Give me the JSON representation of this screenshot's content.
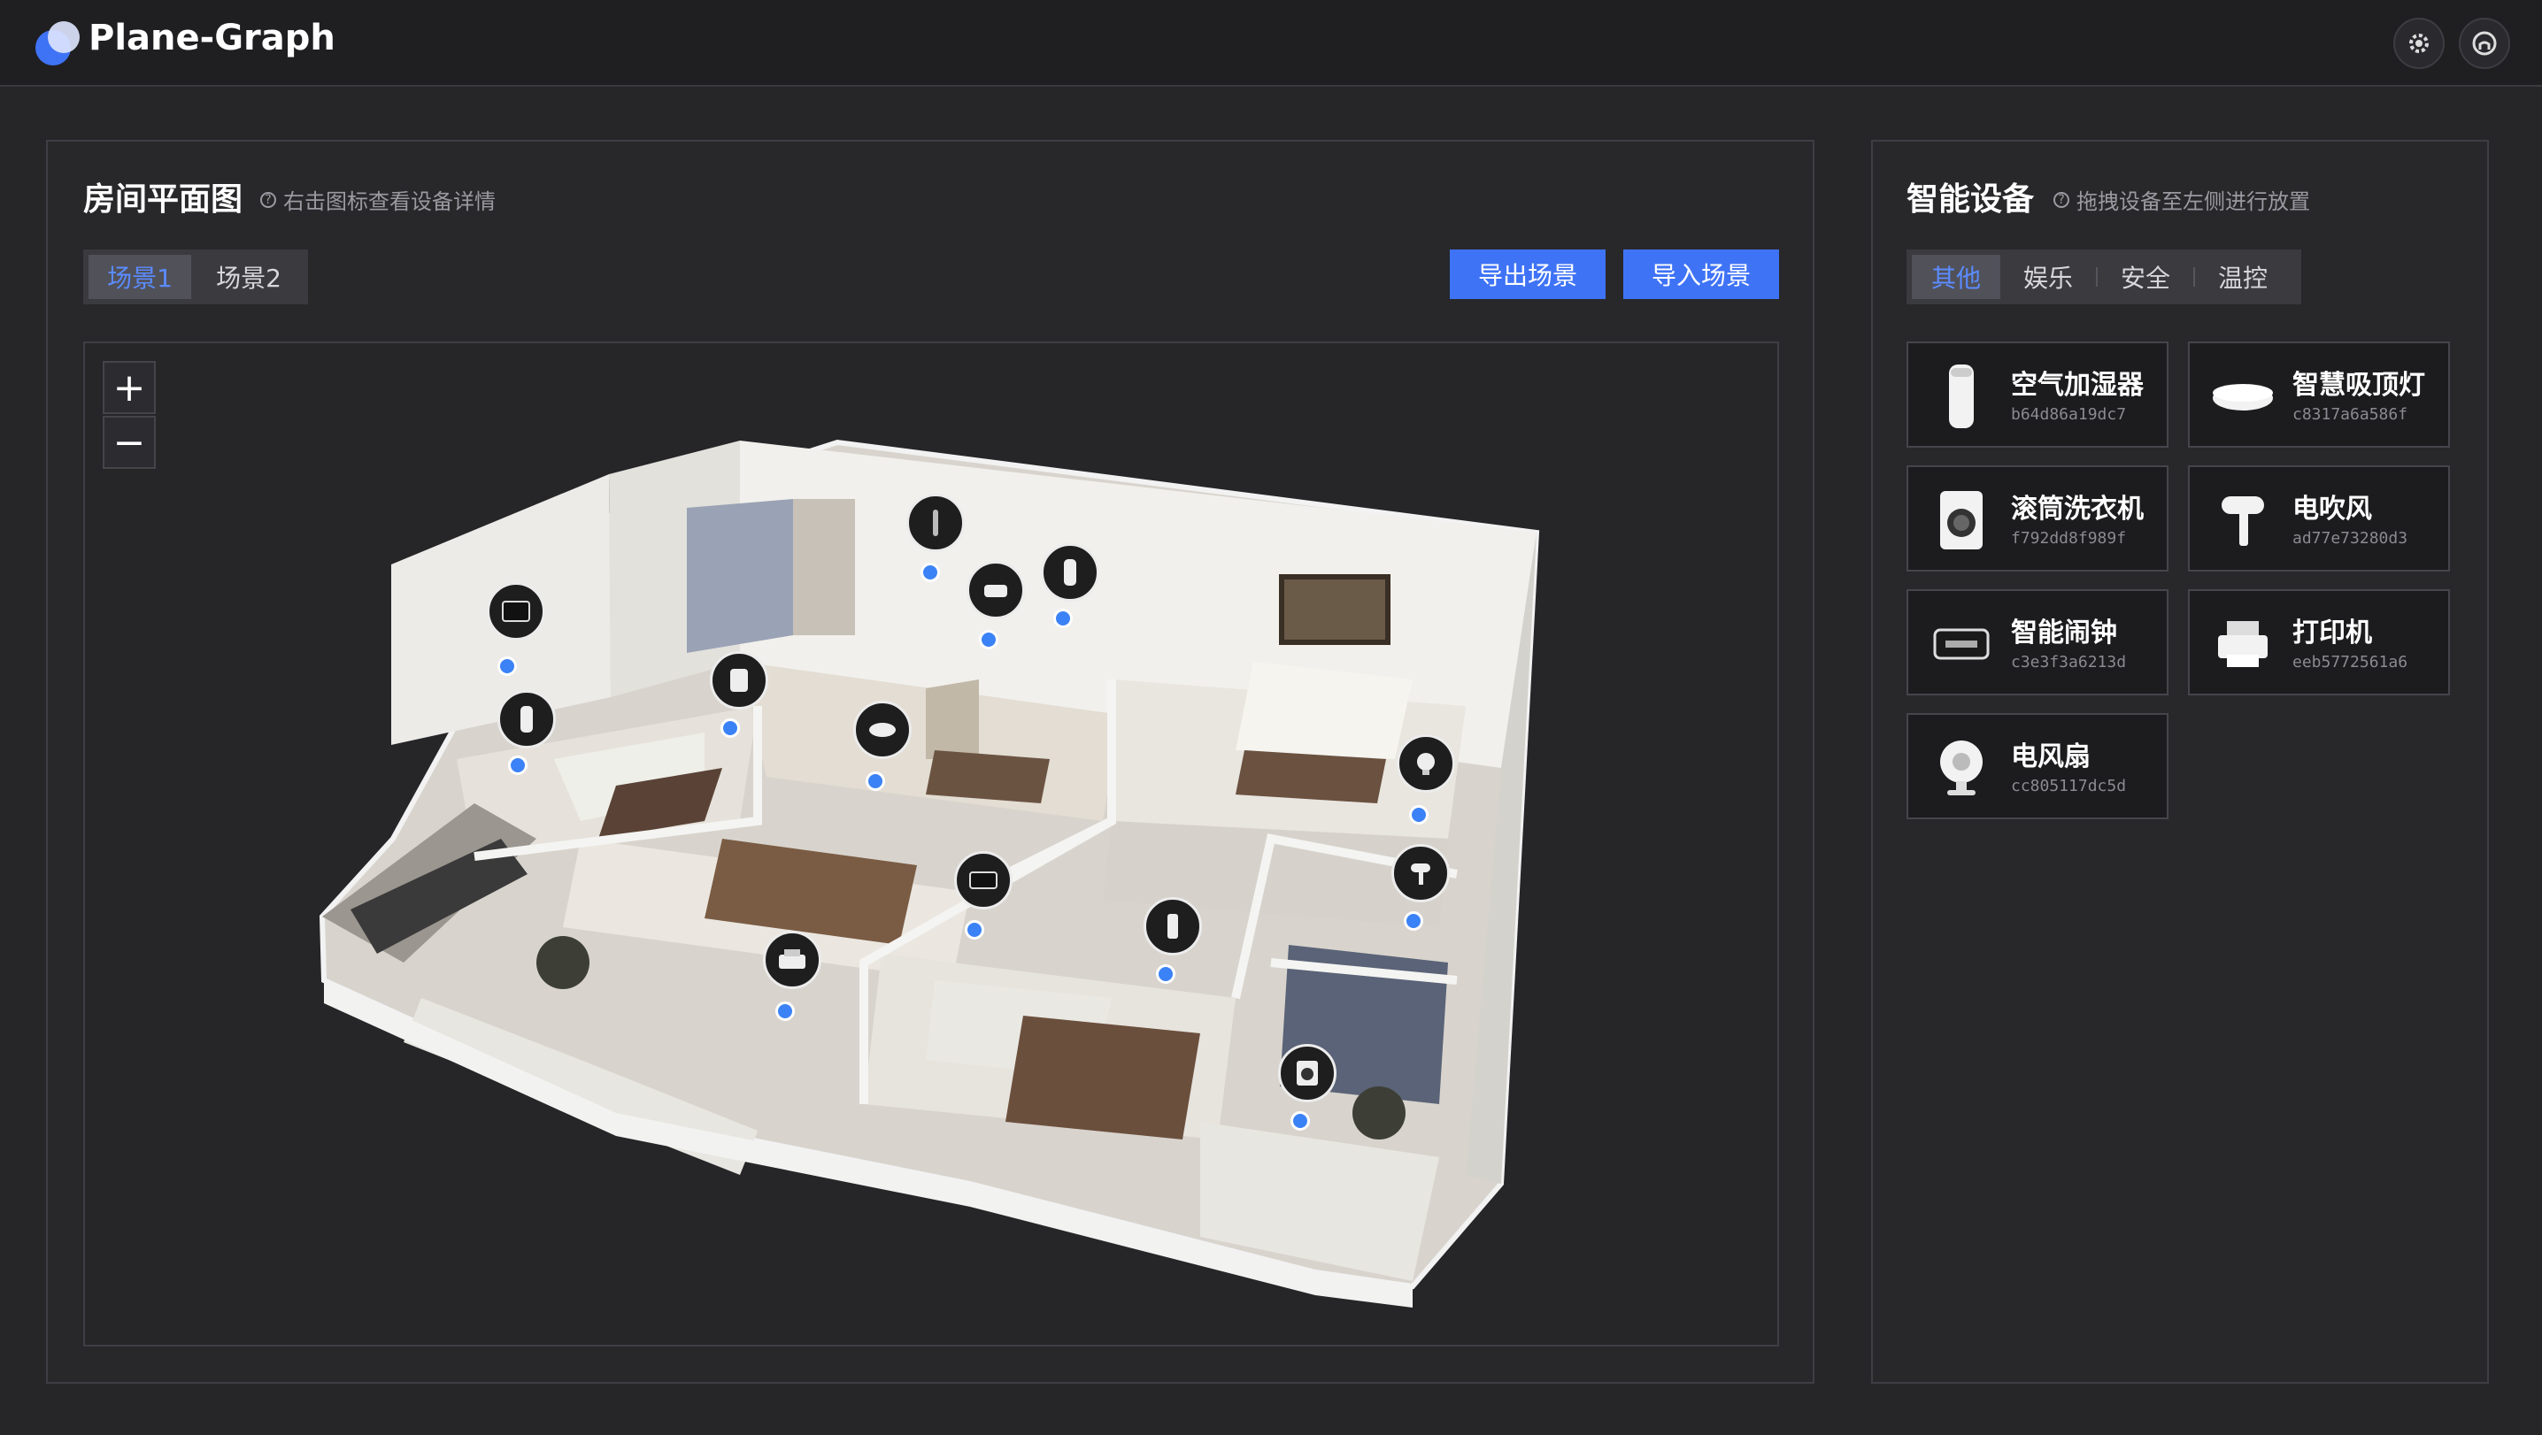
{
  "app": {
    "title": "Plane-Graph"
  },
  "colors": {
    "accent": "#3f73f6",
    "active_tab": "#5b8cff",
    "marker_dot": "#3b82f6",
    "background": "#262629"
  },
  "left_panel": {
    "title": "房间平面图",
    "hint": "右击图标查看设备详情",
    "scenes": [
      {
        "label": "场景1",
        "active": true
      },
      {
        "label": "场景2",
        "active": false
      }
    ],
    "export_label": "导出场景",
    "import_label": "导入场景",
    "zoom_in": "+",
    "zoom_out": "−"
  },
  "right_panel": {
    "title": "智能设备",
    "hint": "拖拽设备至左侧进行放置",
    "categories": [
      {
        "label": "其他",
        "active": true
      },
      {
        "label": "娱乐",
        "active": false
      },
      {
        "label": "安全",
        "active": false
      },
      {
        "label": "温控",
        "active": false
      }
    ],
    "devices": [
      {
        "name": "空气加湿器",
        "id": "b64d86a19dc7",
        "icon": "humidifier-icon"
      },
      {
        "name": "智慧吸顶灯",
        "id": "c8317a6a586f",
        "icon": "ceiling-light-icon"
      },
      {
        "name": "滚筒洗衣机",
        "id": "f792dd8f989f",
        "icon": "washing-machine-icon"
      },
      {
        "name": "电吹风",
        "id": "ad77e73280d3",
        "icon": "hair-dryer-icon"
      },
      {
        "name": "智能闹钟",
        "id": "c3e3f3a6213d",
        "icon": "alarm-clock-icon"
      },
      {
        "name": "打印机",
        "id": "eeb5772561a6",
        "icon": "printer-icon"
      },
      {
        "name": "电风扇",
        "id": "cc805117dc5d",
        "icon": "fan-icon"
      }
    ]
  },
  "floorplan_markers": [
    {
      "device": "alarm-clock"
    },
    {
      "device": "humidifier"
    },
    {
      "device": "dryer"
    },
    {
      "device": "speaker"
    },
    {
      "device": "sofa"
    },
    {
      "device": "humidifier-2"
    },
    {
      "device": "robot-vacuum"
    },
    {
      "device": "alarm-clock-2"
    },
    {
      "device": "printer"
    },
    {
      "device": "phone"
    },
    {
      "device": "fan"
    },
    {
      "device": "hair-dryer"
    },
    {
      "device": "washing-machine"
    }
  ]
}
